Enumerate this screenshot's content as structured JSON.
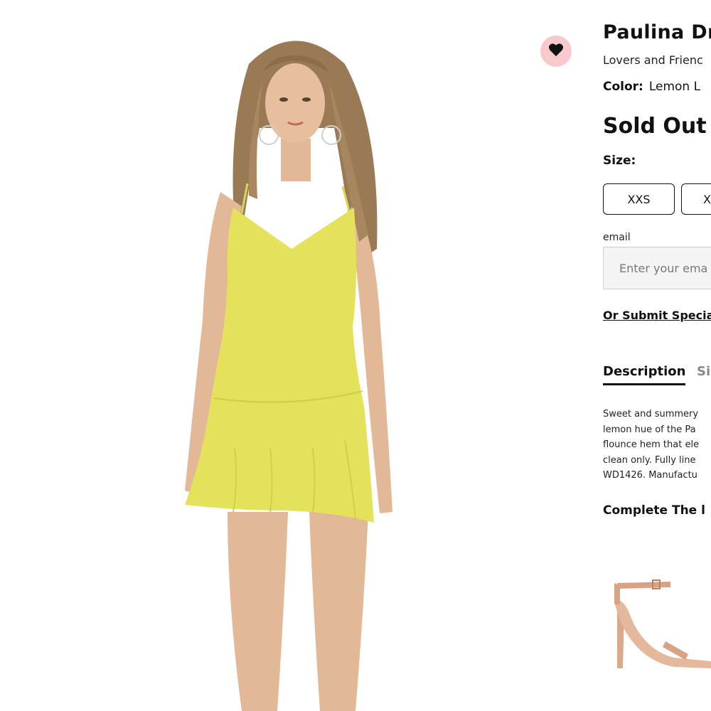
{
  "product": {
    "title": "Paulina Dr",
    "brand": "Lovers and Frienc",
    "color_label": "Color:",
    "color_value": "Lemon L",
    "status": "Sold Out",
    "size_label": "Size:",
    "sizes": [
      "XXS",
      "X"
    ]
  },
  "notify": {
    "email_label": "email",
    "email_placeholder": "Enter your ema",
    "special_order_link": "Or Submit Special"
  },
  "tabs": [
    "Description",
    "Si"
  ],
  "description_lines": [
    "Sweet and summery",
    "lemon hue of the Pa",
    "flounce hem that ele",
    "clean only. Fully line",
    "WD1426. Manufactu"
  ],
  "complete_the_look": "Complete The l",
  "icons": {
    "wishlist": "heart-icon"
  },
  "colors": {
    "wishlist_bg": "#f7c9cd",
    "dress": "#e3e25a",
    "text": "#111111"
  }
}
